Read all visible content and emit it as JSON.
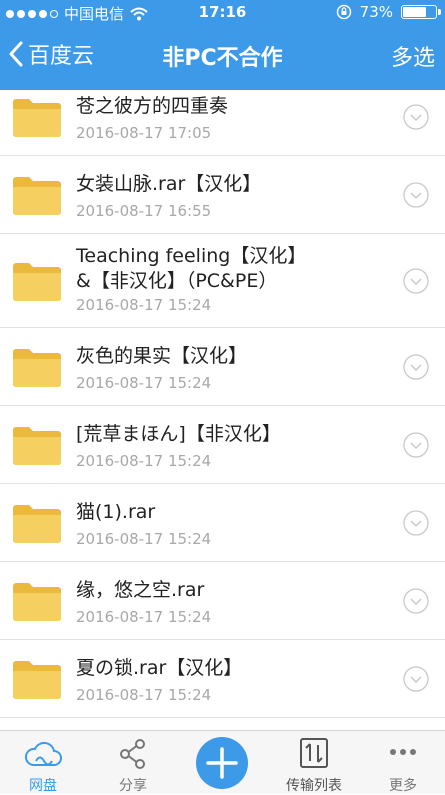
{
  "status_bar": {
    "signal_dots": 5,
    "signal_filled": 4,
    "carrier": "中国电信",
    "time": "17:16",
    "battery_text": "73%",
    "battery_level": 0.73,
    "icons": [
      "wifi-icon",
      "rotation-lock-icon",
      "battery-icon"
    ]
  },
  "nav": {
    "back_label": "百度云",
    "title": "非PC不合作",
    "action_label": "多选"
  },
  "files": [
    {
      "name": "苍之彼方的四重奏",
      "date": "2016-08-17 17:05"
    },
    {
      "name": "女装山脉.rar【汉化】",
      "date": "2016-08-17 16:55"
    },
    {
      "name": "Teaching feeling【汉化】\n&【非汉化】（PC&PE）",
      "date": "2016-08-17 15:24"
    },
    {
      "name": "灰色的果实【汉化】",
      "date": "2016-08-17 15:24"
    },
    {
      "name": "[荒草まほん]【非汉化】",
      "date": "2016-08-17 15:24"
    },
    {
      "name": "猫(1).rar",
      "date": "2016-08-17 15:24"
    },
    {
      "name": "缘，悠之空.rar",
      "date": "2016-08-17 15:24"
    },
    {
      "name": "夏の锁.rar【汉化】",
      "date": "2016-08-17 15:24"
    }
  ],
  "tabbar": {
    "tabs": [
      {
        "label": "网盘",
        "icon": "cloud-icon",
        "active": true
      },
      {
        "label": "分享",
        "icon": "share-icon",
        "active": false
      },
      {
        "label": "",
        "icon": "add-icon",
        "active": false
      },
      {
        "label": "传输列表",
        "icon": "transfer-icon",
        "active": false
      },
      {
        "label": "更多",
        "icon": "more-icon",
        "active": false
      }
    ]
  },
  "colors": {
    "accent": "#3d9ae8",
    "folder": "#f5cf5f",
    "folder_dark": "#eab93d"
  }
}
